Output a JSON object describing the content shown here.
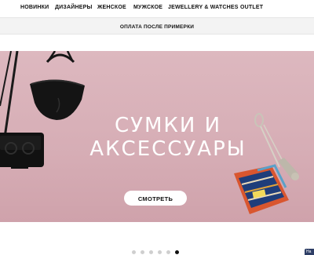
{
  "nav": {
    "items": [
      {
        "label": "НОВИНКИ"
      },
      {
        "label": "ДИЗАЙНЕРЫ"
      },
      {
        "label": "ЖЕНСКОЕ"
      },
      {
        "label": "МУЖСКОЕ"
      },
      {
        "label": "JEWELLERY & WATCHES"
      },
      {
        "label": "OUTLET"
      }
    ]
  },
  "promo_bar": {
    "text": "ОПЛАТА ПОСЛЕ ПРИМЕРКИ"
  },
  "hero": {
    "title_line1": "СУМКИ И",
    "title_line2": "АКСЕССУАРЫ",
    "cta_label": "СМОТРЕТЬ",
    "background_color": "#d8b1b8",
    "products": [
      "black-bucket-bag-icon",
      "black-crossbody-bag-icon",
      "safety-pin-brooch-icon",
      "striped-wallet-icon"
    ]
  },
  "carousel": {
    "dot_count": 6,
    "active_index": 5
  },
  "chat_tab": {
    "label": "На"
  }
}
